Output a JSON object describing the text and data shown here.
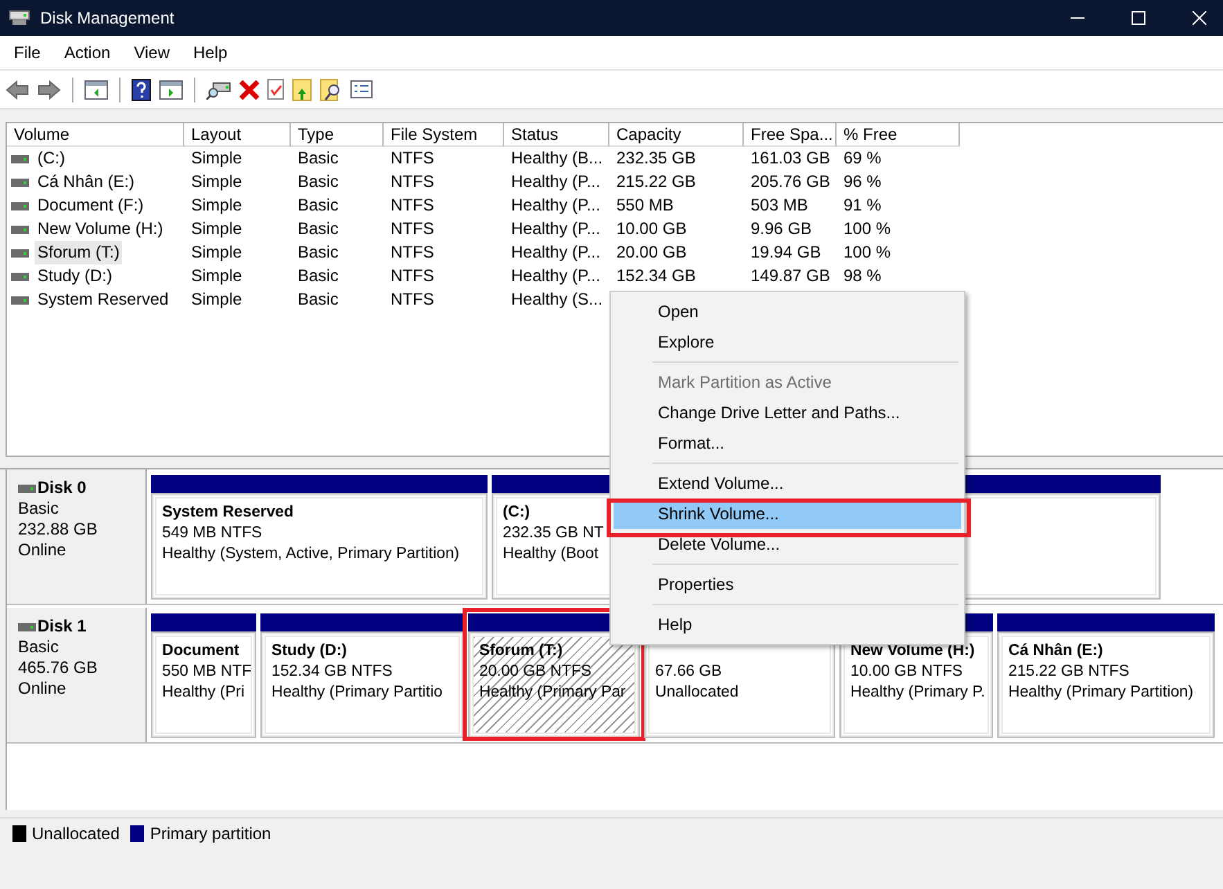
{
  "window": {
    "title": "Disk Management"
  },
  "menu_bar": [
    "File",
    "Action",
    "View",
    "Help"
  ],
  "volume_table": {
    "columns": [
      "Volume",
      "Layout",
      "Type",
      "File System",
      "Status",
      "Capacity",
      "Free Spa...",
      "% Free"
    ],
    "rows": [
      {
        "selected": false,
        "cells": [
          " (C:)",
          "Simple",
          "Basic",
          "NTFS",
          "Healthy (B...",
          "232.35 GB",
          "161.03 GB",
          "69 %"
        ]
      },
      {
        "selected": false,
        "cells": [
          "Cá Nhân (E:)",
          "Simple",
          "Basic",
          "NTFS",
          "Healthy (P...",
          "215.22 GB",
          "205.76 GB",
          "96 %"
        ]
      },
      {
        "selected": false,
        "cells": [
          "Document (F:)",
          "Simple",
          "Basic",
          "NTFS",
          "Healthy (P...",
          "550 MB",
          "503 MB",
          "91 %"
        ]
      },
      {
        "selected": false,
        "cells": [
          "New Volume (H:)",
          "Simple",
          "Basic",
          "NTFS",
          "Healthy (P...",
          "10.00 GB",
          "9.96 GB",
          "100 %"
        ]
      },
      {
        "selected": true,
        "cells": [
          "Sforum (T:)",
          "Simple",
          "Basic",
          "NTFS",
          "Healthy (P...",
          "20.00 GB",
          "19.94 GB",
          "100 %"
        ]
      },
      {
        "selected": false,
        "cells": [
          "Study (D:)",
          "Simple",
          "Basic",
          "NTFS",
          "Healthy (P...",
          "152.34 GB",
          "149.87 GB",
          "98 %"
        ]
      },
      {
        "selected": false,
        "cells": [
          "System Reserved",
          "Simple",
          "Basic",
          "NTFS",
          "Healthy (S..."
        ]
      }
    ]
  },
  "disks": [
    {
      "name": "Disk 0",
      "type": "Basic",
      "size": "232.88 GB",
      "status": "Online",
      "partitions": [
        {
          "kind": "primary",
          "selected": false,
          "title": "System Reserved",
          "size": "549 MB NTFS",
          "status": "Healthy (System, Active, Primary Partition)"
        },
        {
          "kind": "primary",
          "selected": false,
          "title": "(C:)",
          "size": "232.35 GB NT",
          "status": "Healthy (Boot"
        }
      ]
    },
    {
      "name": "Disk 1",
      "type": "Basic",
      "size": "465.76 GB",
      "status": "Online",
      "partitions": [
        {
          "kind": "primary",
          "selected": false,
          "title": "Document",
          "size": "550 MB NTF",
          "status": "Healthy (Pri"
        },
        {
          "kind": "primary",
          "selected": false,
          "title": "Study  (D:)",
          "size": "152.34 GB NTFS",
          "status": "Healthy (Primary Partitio"
        },
        {
          "kind": "primary",
          "selected": true,
          "title": "Sforum  (T:)",
          "size": "20.00 GB NTFS",
          "status": "Healthy (Primary Par"
        },
        {
          "kind": "unallocated",
          "selected": false,
          "size": "67.66 GB",
          "status": "Unallocated"
        },
        {
          "kind": "primary",
          "selected": false,
          "title": "New Volume  (H:)",
          "size": "10.00 GB NTFS",
          "status": "Healthy (Primary P."
        },
        {
          "kind": "primary",
          "selected": false,
          "title": "Cá Nhân  (E:)",
          "size": "215.22 GB NTFS",
          "status": "Healthy (Primary Partition)"
        }
      ]
    }
  ],
  "context_menu": {
    "items": [
      {
        "kind": "item",
        "label": "Open",
        "disabled": false,
        "selected": false
      },
      {
        "kind": "item",
        "label": "Explore",
        "disabled": false,
        "selected": false
      },
      {
        "kind": "separator"
      },
      {
        "kind": "item",
        "label": "Mark Partition as Active",
        "disabled": true,
        "selected": false
      },
      {
        "kind": "item",
        "label": "Change Drive Letter and Paths...",
        "disabled": false,
        "selected": false
      },
      {
        "kind": "item",
        "label": "Format...",
        "disabled": false,
        "selected": false
      },
      {
        "kind": "separator"
      },
      {
        "kind": "item",
        "label": "Extend Volume...",
        "disabled": false,
        "selected": false
      },
      {
        "kind": "item",
        "label": "Shrink Volume...",
        "disabled": false,
        "selected": true
      },
      {
        "kind": "item",
        "label": "Delete Volume...",
        "disabled": false,
        "selected": false
      },
      {
        "kind": "separator"
      },
      {
        "kind": "item",
        "label": "Properties",
        "disabled": false,
        "selected": false
      },
      {
        "kind": "separator"
      },
      {
        "kind": "item",
        "label": "Help",
        "disabled": false,
        "selected": false
      }
    ]
  },
  "legend": [
    {
      "label": "Unallocated",
      "color": "#000000"
    },
    {
      "label": "Primary partition",
      "color": "#000080"
    }
  ]
}
